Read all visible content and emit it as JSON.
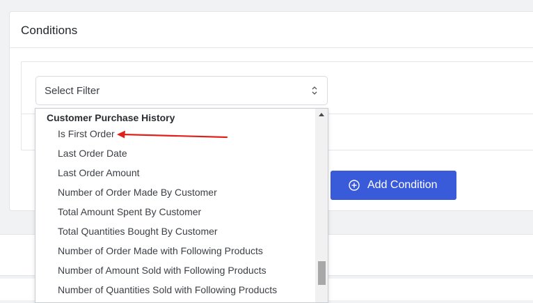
{
  "card": {
    "title": "Conditions"
  },
  "filter_select": {
    "value": "Select Filter",
    "icon": "chevron-up-down-icon"
  },
  "add_condition": {
    "label": "Add Condition",
    "icon": "plus-circle-icon",
    "color": "#3a5bd9"
  },
  "dropdown": {
    "group_label": "Customer Purchase History",
    "items": [
      "Is First Order",
      "Last Order Date",
      "Last Order Amount",
      "Number of Order Made By Customer",
      "Total Amount Spent By Customer",
      "Total Quantities Bought By Customer",
      "Number of Order Made with Following Products",
      "Number of Amount Sold with Following Products",
      "Number of Quantities Sold with Following Products"
    ]
  },
  "annotation": {
    "arrow_color": "#e0201b",
    "points_to": "Is First Order"
  }
}
